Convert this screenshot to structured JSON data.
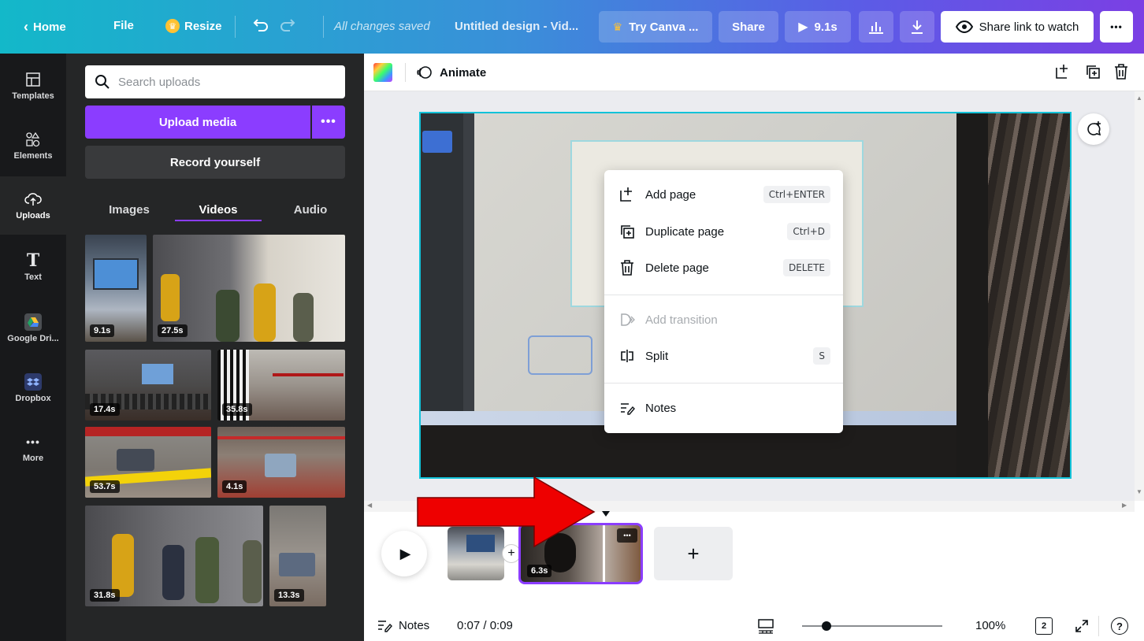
{
  "topbar": {
    "home_label": "Home",
    "file_label": "File",
    "resize_label": "Resize",
    "saved_status": "All changes saved",
    "design_title": "Untitled design - Vid...",
    "try_canva_label": "Try Canva ...",
    "share_label": "Share",
    "duration_label": "9.1s",
    "share_link_label": "Share link to watch",
    "more_label": "•••"
  },
  "rail": {
    "items": [
      {
        "label": "Templates",
        "icon": "templates-icon"
      },
      {
        "label": "Elements",
        "icon": "elements-icon"
      },
      {
        "label": "Uploads",
        "icon": "uploads-icon"
      },
      {
        "label": "Text",
        "icon": "text-icon"
      },
      {
        "label": "Google Dri...",
        "icon": "google-drive-icon"
      },
      {
        "label": "Dropbox",
        "icon": "dropbox-icon"
      },
      {
        "label": "More",
        "icon": "more-icon"
      }
    ]
  },
  "panel": {
    "search_placeholder": "Search uploads",
    "upload_label": "Upload media",
    "upload_more": "•••",
    "record_label": "Record yourself",
    "tabs": [
      "Images",
      "Videos",
      "Audio"
    ],
    "durations": [
      "9.1s",
      "27.5s",
      "17.4s",
      "35.8s",
      "53.7s",
      "4.1s",
      "31.8s",
      "13.3s"
    ]
  },
  "editor": {
    "animate_label": "Animate"
  },
  "context_menu": {
    "add_page": "Add page",
    "add_page_kbd": "Ctrl+ENTER",
    "duplicate_page": "Duplicate page",
    "duplicate_page_kbd": "Ctrl+D",
    "delete_page": "Delete page",
    "delete_page_kbd": "DELETE",
    "add_transition": "Add transition",
    "split": "Split",
    "split_kbd": "S",
    "notes": "Notes"
  },
  "timeline": {
    "clip_duration": "6.3s",
    "clip_more": "•••",
    "add_symbol": "+"
  },
  "footer": {
    "notes_label": "Notes",
    "time": "0:07 / 0:09",
    "zoom": "100%",
    "page_count": "2",
    "zoom_level": 0.04
  },
  "colors": {
    "accent": "#8b3dff",
    "selection": "#12c2d8",
    "annotation_arrow": "#ee0000"
  }
}
